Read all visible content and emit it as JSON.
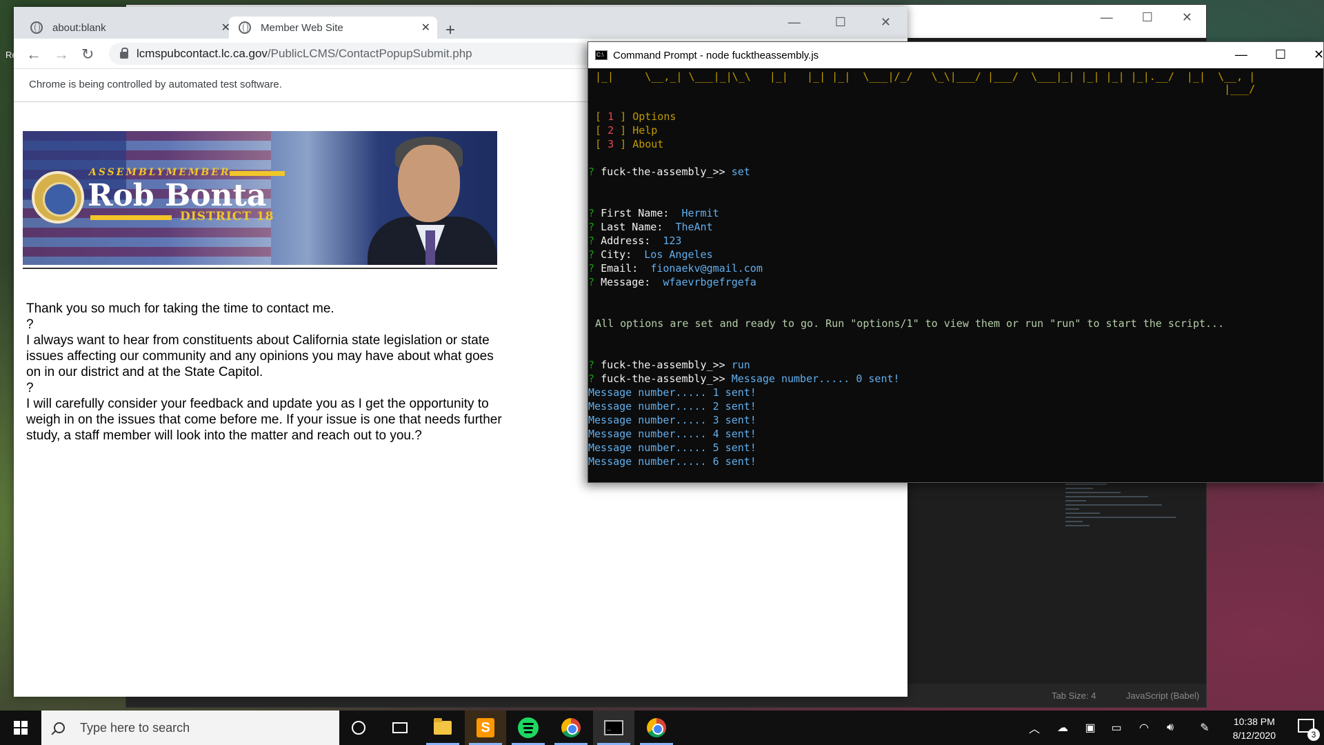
{
  "desktop": {
    "label": "Re"
  },
  "editor": {
    "status_tab_size": "Tab Size: 4",
    "status_language": "JavaScript (Babel)"
  },
  "browser": {
    "tabs": [
      {
        "title": "about:blank"
      },
      {
        "title": "Member Web Site"
      }
    ],
    "url_host": "lcmspubcontact.lc.ca.gov",
    "url_path": "/PublicLCMS/ContactPopupSubmit.php",
    "infobar": "Chrome is being controlled by automated test software.",
    "banner": {
      "title": "ASSEMBLYMEMBER",
      "name": "Rob Bonta",
      "district": "DISTRICT 18"
    },
    "message_lines": [
      "Thank you so much for taking the time to contact me.",
      "?",
      "I always want to hear from constituents about California state legislation or state issues affecting our community and any opinions you may have about what goes on in our district and at the State Capitol.",
      "?",
      "I will carefully consider your feedback and update you as I get the opportunity to weigh in on the issues that come before me. If your issue is one that needs further study, a staff member will look into the matter and reach out to you.?"
    ]
  },
  "cmd": {
    "title": "Command Prompt - node  fucktheassembly.js",
    "ascii_line1": "|_|     \\__,_| \\___|_|\\_\\   |_|   |_| |_|  \\___|/_/   \\_\\|___/ |___/  \\___|_| |_| |_| |_|.__/  |_|  \\__, |",
    "ascii_line2": "                                                                                                     |___/",
    "menu": [
      {
        "num": "1",
        "label": "Options"
      },
      {
        "num": "2",
        "label": "Help"
      },
      {
        "num": "3",
        "label": "About"
      }
    ],
    "prompt": "fuck-the-assembly_>>",
    "cmd_set": "set",
    "fields": [
      {
        "label": "First Name:",
        "value": "Hermit"
      },
      {
        "label": "Last Name:",
        "value": "TheAnt"
      },
      {
        "label": "Address:",
        "value": "123"
      },
      {
        "label": "City:",
        "value": "Los Angeles"
      },
      {
        "label": "Email:",
        "value": "fionaekv@gmail.com"
      },
      {
        "label": "Message:",
        "value": "wfaevrbgefrgefa"
      }
    ],
    "ready_msg": "All options are set and ready to go. Run \"options/1\" to view them or run \"run\" to start the script...",
    "cmd_run": "run",
    "first_sent": "Message number..... 0 sent!",
    "sent_lines": [
      "Message number..... 1 sent!",
      "Message number..... 2 sent!",
      "Message number..... 3 sent!",
      "Message number..... 4 sent!",
      "Message number..... 5 sent!",
      "Message number..... 6 sent!"
    ]
  },
  "taskbar": {
    "search_placeholder": "Type here to search",
    "time": "10:38 PM",
    "date": "8/12/2020",
    "notif_count": "3"
  }
}
